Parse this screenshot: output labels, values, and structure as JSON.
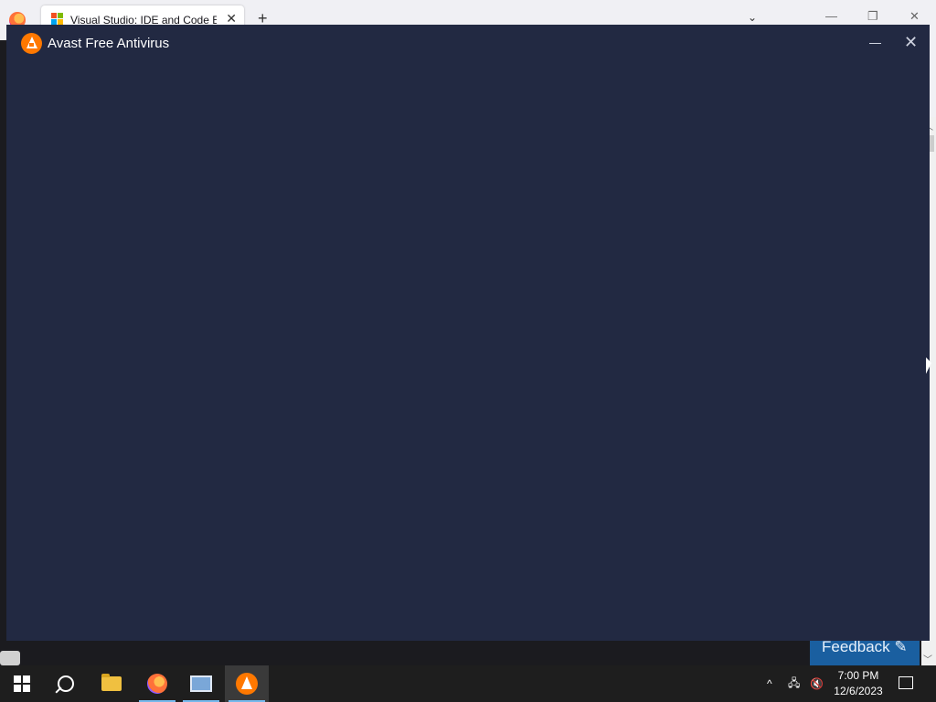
{
  "browser": {
    "tab_title": "Visual Studio: IDE and Code Edi",
    "tab_close": "✕",
    "new_tab": "+",
    "tab_list": "⌄",
    "minimize": "—",
    "restore": "❐",
    "close": "✕",
    "feedback_label": "Feedback ✎"
  },
  "avast_window": {
    "title": "Avast Free Antivirus",
    "close_glyph": "✕"
  },
  "taskbar": {
    "items": [
      "start",
      "search",
      "file-explorer",
      "firefox",
      "network-tool",
      "avast"
    ],
    "tray_chevron": "^",
    "time": "7:00 PM",
    "date": "12/6/2023"
  },
  "colors": {
    "avast_bg": "#222942",
    "avast_orange": "#ff7800",
    "taskbar_bg": "#1e1e1e",
    "feedback_bg": "#1a5fa0"
  }
}
